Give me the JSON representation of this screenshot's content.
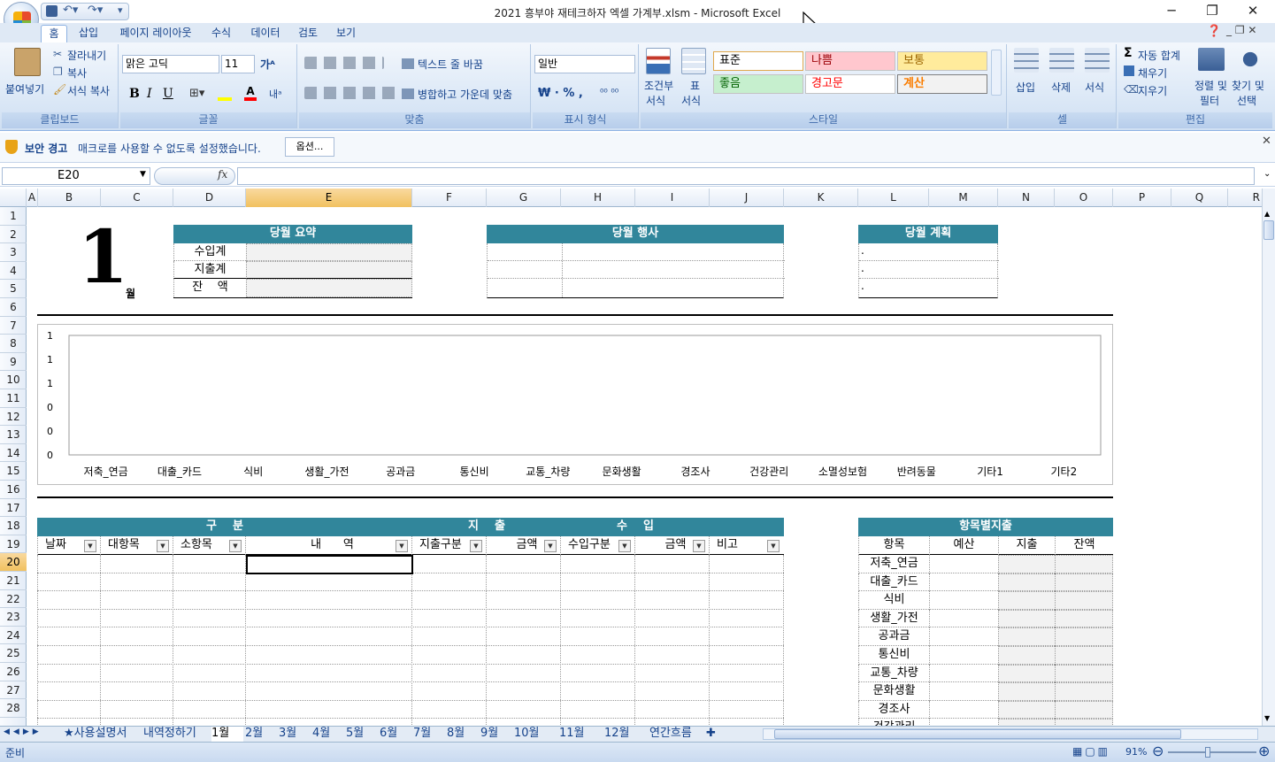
{
  "window": {
    "title": "2021 흥부야 재테크하자 엑셀 가계부.xlsm - Microsoft Excel",
    "minimize": "─",
    "restore": "❐",
    "close": "✕"
  },
  "tabs": [
    "홈",
    "삽입",
    "페이지 레이아웃",
    "수식",
    "데이터",
    "검토",
    "보기"
  ],
  "ribbon": {
    "clipboard": {
      "paste": "붙여넣기",
      "cut": "잘라내기",
      "copy": "복사",
      "format_painter": "서식 복사",
      "label": "클립보드"
    },
    "font": {
      "name": "맑은 고딕",
      "size": "11",
      "bold": "B",
      "italic": "I",
      "underline": "U",
      "label": "글꼴"
    },
    "align": {
      "wrap": "텍스트 줄 바꿈",
      "merge": "병합하고 가운데 맞춤",
      "label": "맞춤"
    },
    "number": {
      "format": "일반",
      "label": "표시 형식"
    },
    "styles": {
      "cond": "조건부",
      "cond2": "서식",
      "table": "표",
      "table2": "서식",
      "normal": "표준",
      "bad": "나쁨",
      "neutral": "보통",
      "good": "좋음",
      "warning": "경고문",
      "calc": "계산",
      "label": "스타일"
    },
    "cells": {
      "insert": "삽입",
      "delete": "삭제",
      "format": "서식",
      "label": "셀"
    },
    "editing": {
      "autosum": "자동 합계",
      "fill": "채우기",
      "clear": "지우기",
      "sort": "정렬 및",
      "sort2": "필터",
      "find": "찾기 및",
      "find2": "선택",
      "label": "편집"
    }
  },
  "security": {
    "title": "보안 경고",
    "message": "매크로를 사용할 수 없도록 설정했습니다.",
    "button": "옵션..."
  },
  "formula": {
    "namebox": "E20",
    "fx": "fx",
    "value": ""
  },
  "columns": [
    "A",
    "B",
    "C",
    "D",
    "E",
    "F",
    "G",
    "H",
    "I",
    "J",
    "K",
    "L",
    "M",
    "N",
    "O",
    "P",
    "Q",
    "R"
  ],
  "rows": [
    "1",
    "2",
    "3",
    "4",
    "5",
    "6",
    "7",
    "8",
    "9",
    "10",
    "11",
    "12",
    "13",
    "14",
    "15",
    "16",
    "17",
    "18",
    "19",
    "20",
    "21",
    "22",
    "23",
    "24",
    "25",
    "26",
    "27",
    "28"
  ],
  "sheet": {
    "month_num": "1",
    "month_unit": "월",
    "summary": {
      "title": "당월 요약",
      "rows": [
        "수입계",
        "지출계",
        "잔    액"
      ]
    },
    "events": {
      "title": "당월 행사"
    },
    "plan": {
      "title": "당월 계획",
      "bullets": [
        ".",
        ".",
        "."
      ]
    },
    "ledger": {
      "group_div": "구    분",
      "group_out": "지    출",
      "group_in": "수    입",
      "cols": [
        "날짜",
        "대항목",
        "소항목",
        "내      역",
        "지출구분",
        "금액",
        "수입구분",
        "금액",
        "비고"
      ]
    },
    "category": {
      "title": "항목별지출",
      "cols": [
        "항목",
        "예산",
        "지출",
        "잔액"
      ],
      "items": [
        "저축_연금",
        "대출_카드",
        "식비",
        "생활_가전",
        "공과금",
        "통신비",
        "교통_차량",
        "문화생활",
        "경조사",
        "건강관리"
      ]
    }
  },
  "chart_data": {
    "type": "bar",
    "categories": [
      "저축_연금",
      "대출_카드",
      "식비",
      "생활_가전",
      "공과금",
      "통신비",
      "교통_차량",
      "문화생활",
      "경조사",
      "건강관리",
      "소멸성보험",
      "반려동물",
      "기타1",
      "기타2"
    ],
    "values": [
      0,
      0,
      0,
      0,
      0,
      0,
      0,
      0,
      0,
      0,
      0,
      0,
      0,
      0
    ],
    "y_ticks": [
      "1",
      "1",
      "1",
      "0",
      "0",
      "0"
    ],
    "title": "",
    "xlabel": "",
    "ylabel": ""
  },
  "sheet_tabs": [
    "★사용설명서",
    "내역정하기",
    "1월",
    "2월",
    "3월",
    "4월",
    "5월",
    "6월",
    "7월",
    "8월",
    "9월",
    "10월",
    "11월",
    "12월",
    "연간흐름"
  ],
  "status": {
    "ready": "준비",
    "zoom": "91%"
  }
}
